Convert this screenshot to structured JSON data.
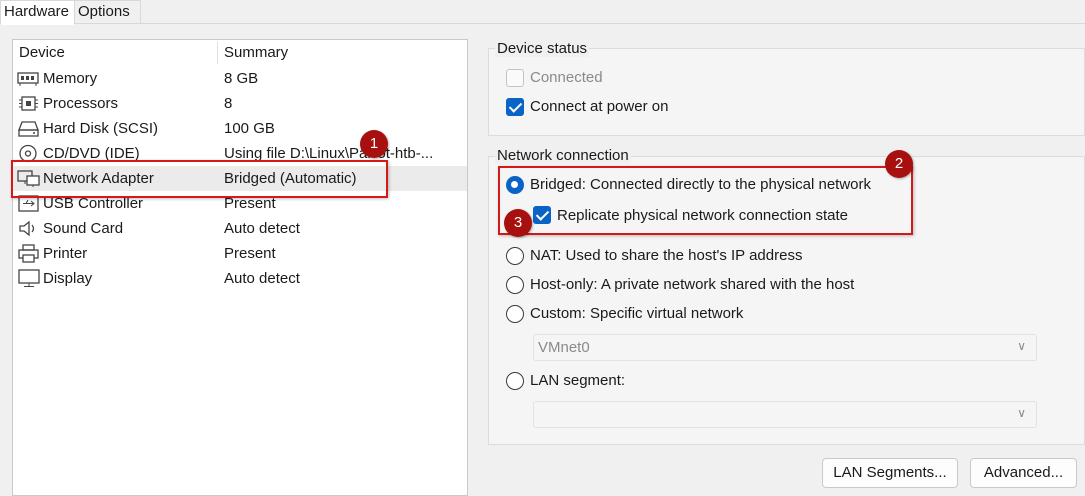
{
  "tabs": [
    {
      "label": "Hardware",
      "active": true
    },
    {
      "label": "Options",
      "active": false
    }
  ],
  "device_list": {
    "headers": {
      "device": "Device",
      "summary": "Summary"
    },
    "rows": [
      {
        "icon": "memory-icon",
        "name": "Memory",
        "summary": "8 GB"
      },
      {
        "icon": "processor-icon",
        "name": "Processors",
        "summary": "8"
      },
      {
        "icon": "hard-disk-icon",
        "name": "Hard Disk (SCSI)",
        "summary": "100 GB"
      },
      {
        "icon": "cd-dvd-icon",
        "name": "CD/DVD (IDE)",
        "summary": "Using file D:\\Linux\\Parrot-htb-..."
      },
      {
        "icon": "network-adapter-icon",
        "name": "Network Adapter",
        "summary": "Bridged (Automatic)",
        "selected": true
      },
      {
        "icon": "usb-icon",
        "name": "USB Controller",
        "summary": "Present"
      },
      {
        "icon": "sound-card-icon",
        "name": "Sound Card",
        "summary": "Auto detect"
      },
      {
        "icon": "printer-icon",
        "name": "Printer",
        "summary": "Present"
      },
      {
        "icon": "display-icon",
        "name": "Display",
        "summary": "Auto detect"
      }
    ]
  },
  "device_status": {
    "title": "Device status",
    "connected": {
      "label": "Connected",
      "checked": false,
      "enabled": false
    },
    "connect_at_power_on": {
      "label": "Connect at power on",
      "checked": true
    }
  },
  "network_connection": {
    "title": "Network connection",
    "bridged": {
      "label": "Bridged: Connected directly to the physical network",
      "selected": true
    },
    "replicate": {
      "label": "Replicate physical network connection state",
      "checked": true
    },
    "nat": {
      "label": "NAT: Used to share the host's IP address",
      "selected": false
    },
    "host_only": {
      "label": "Host-only: A private network shared with the host",
      "selected": false
    },
    "custom": {
      "label": "Custom: Specific virtual network",
      "selected": false
    },
    "custom_select": {
      "value": "VMnet0"
    },
    "lan_segment": {
      "label": "LAN segment:",
      "selected": false
    },
    "lan_select": {
      "value": ""
    }
  },
  "buttons": {
    "lan_segments": "LAN Segments...",
    "advanced": "Advanced..."
  },
  "annotations": {
    "badge_1": "1",
    "badge_2": "2",
    "badge_3": "3",
    "color": "#d41919"
  },
  "colors": {
    "accent": "#0a64c8",
    "annotation_red": "#d41919",
    "badge": "#a80f0f"
  }
}
